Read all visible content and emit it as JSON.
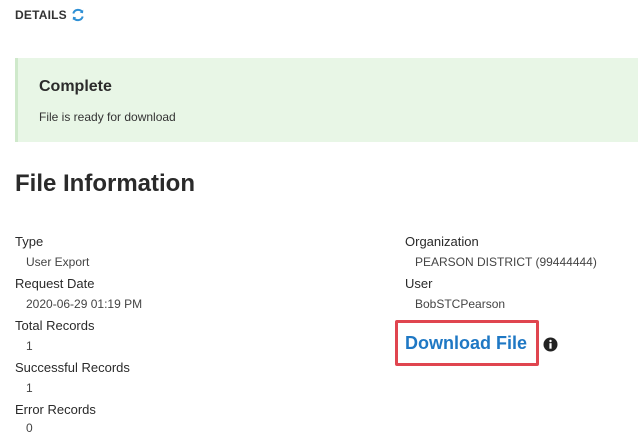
{
  "header": {
    "label": "DETAILS",
    "refresh_icon": "refresh-icon"
  },
  "status": {
    "title": "Complete",
    "message": "File is ready for download",
    "background_color": "#e8f6e6"
  },
  "section": {
    "title": "File Information"
  },
  "fields_left": [
    {
      "label": "Type",
      "value": "User Export"
    },
    {
      "label": "Request Date",
      "value": "2020-06-29 01:19 PM"
    },
    {
      "label": "Total Records",
      "value": "1"
    },
    {
      "label": "Successful Records",
      "value": "1"
    },
    {
      "label": "Error Records",
      "value": "0"
    }
  ],
  "fields_right": [
    {
      "label": "Organization",
      "value": "PEARSON DISTRICT (99444444)"
    },
    {
      "label": "User",
      "value": "BobSTCPearson"
    }
  ],
  "download": {
    "label": "Download File",
    "info_icon": "info-icon",
    "link_color": "#1f78c4",
    "highlight_color": "#e0454f"
  }
}
